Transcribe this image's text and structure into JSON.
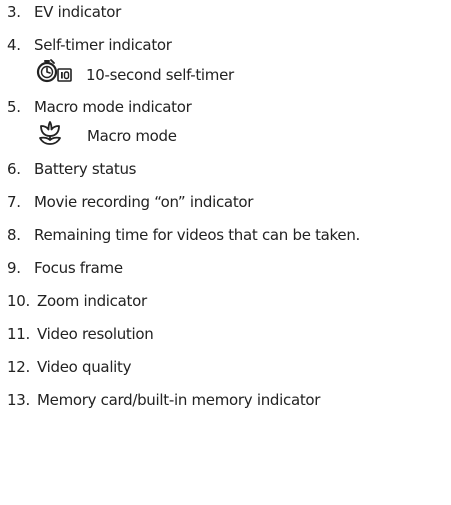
{
  "items": [
    {
      "number": "3.",
      "label": "EV indicator"
    },
    {
      "number": "4.",
      "label": "Self-timer indicator"
    },
    {
      "number": "5.",
      "label": "Macro mode indicator"
    },
    {
      "number": "6.",
      "label": "Battery status"
    },
    {
      "number": "7.",
      "label": "Movie recording “on” indicator"
    },
    {
      "number": "8.",
      "label": "Remaining time for videos that can be taken."
    },
    {
      "number": "9.",
      "label": "Focus frame"
    },
    {
      "number": "10.",
      "label": "Zoom indicator"
    },
    {
      "number": "11.",
      "label": "Video resolution"
    },
    {
      "number": "12.",
      "label": "Video quality"
    },
    {
      "number": "13.",
      "label": "Memory card/built-in memory indicator"
    }
  ],
  "sub_items": {
    "self_timer": {
      "icon": "self-timer-10s-icon",
      "label": "10-second self-timer"
    },
    "macro": {
      "icon": "macro-flower-icon",
      "label": "Macro mode"
    }
  }
}
